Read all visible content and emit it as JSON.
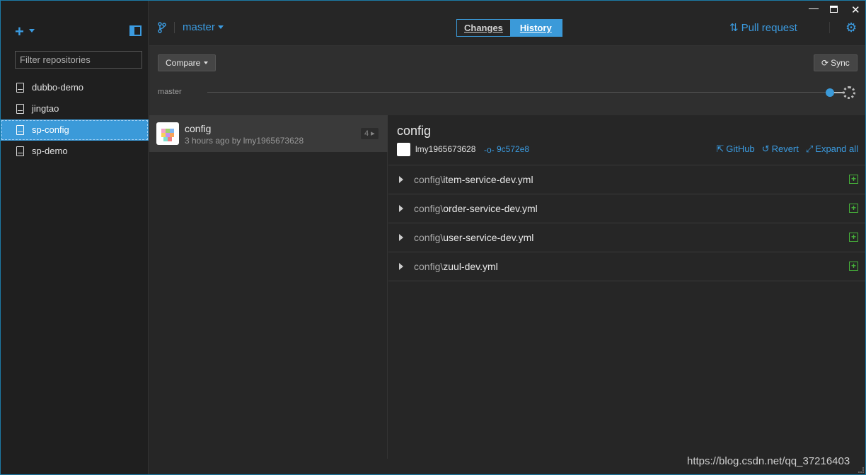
{
  "sidebar": {
    "add_label": "+",
    "filter_placeholder": "Filter repositories",
    "repos": [
      {
        "label": "dubbo-demo"
      },
      {
        "label": "jingtao"
      },
      {
        "label": "sp-config"
      },
      {
        "label": "sp-demo"
      }
    ]
  },
  "header": {
    "branch": "master",
    "tabs": [
      {
        "label": "Changes"
      },
      {
        "label": "History"
      }
    ],
    "pull_request": "Pull request"
  },
  "band": {
    "compare_label": "Compare",
    "sync_label": "Sync",
    "timeline_branch": "master"
  },
  "commits": [
    {
      "title": "config",
      "meta": "3 hours ago by lmy1965673628",
      "count": "4"
    }
  ],
  "detail": {
    "title": "config",
    "author": "lmy1965673628",
    "sha": "9c572e8",
    "actions": {
      "github": "GitHub",
      "revert": "Revert",
      "expand": "Expand all"
    },
    "files": [
      {
        "dir": "config\\",
        "name": "item-service-dev.yml"
      },
      {
        "dir": "config\\",
        "name": "order-service-dev.yml"
      },
      {
        "dir": "config\\",
        "name": "user-service-dev.yml"
      },
      {
        "dir": "config\\",
        "name": "zuul-dev.yml"
      }
    ]
  },
  "watermark": "https://blog.csdn.net/qq_37216403",
  "colors": {
    "accent": "#3b9ad9",
    "added": "#46b33a"
  }
}
